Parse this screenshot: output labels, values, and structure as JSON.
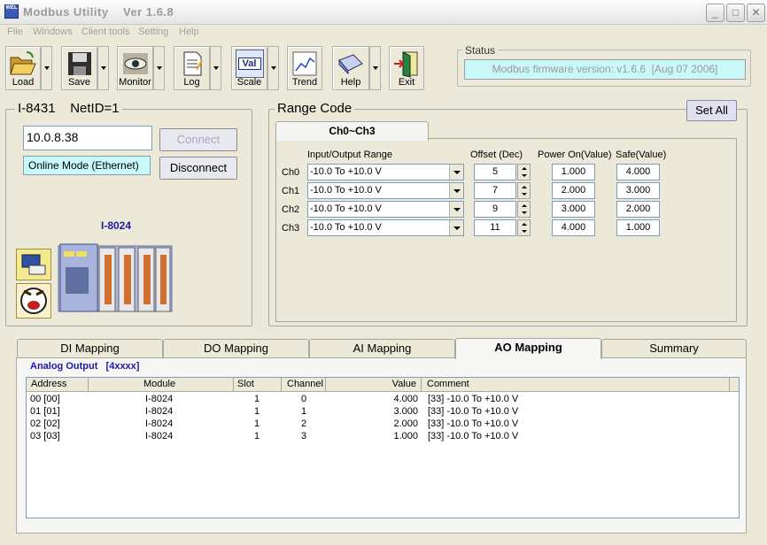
{
  "window": {
    "title": "Modbus Utility    Ver 1.6.8",
    "app_icon_text": "WEL"
  },
  "menu": [
    "File",
    "Windows",
    "Client tools",
    "Setting",
    "Help"
  ],
  "toolbar": {
    "buttons": [
      {
        "label": "Load",
        "icon": "folder-open-icon"
      },
      {
        "label": "Save",
        "icon": "floppy-disk-icon"
      },
      {
        "label": "Monitor",
        "icon": "eye-icon"
      },
      {
        "label": "Log",
        "icon": "log-document-icon"
      },
      {
        "label": "Scale",
        "icon": "scale-val-icon",
        "icon_text": "Val"
      },
      {
        "label": "Trend",
        "icon": "trend-chart-icon"
      },
      {
        "label": "Help",
        "icon": "help-book-icon"
      },
      {
        "label": "Exit",
        "icon": "exit-door-icon"
      }
    ]
  },
  "status": {
    "legend": "Status",
    "text": "Modbus firmware version: v1.6.6  [Aug 07 2006]"
  },
  "device": {
    "legend": "I-8431    NetID=1",
    "ip": "10.0.8.38",
    "connect_label": "Connect",
    "disconnect_label": "Disconnect",
    "mode": "Online Mode (Ethernet)",
    "module_name": "I-8024"
  },
  "range_code": {
    "legend": "Range Code",
    "set_all_label": "Set All",
    "tab_label": "Ch0~Ch3",
    "headers": {
      "range": "Input/Output Range",
      "offset": "Offset (Dec)",
      "power_on": "Power On(Value)",
      "safe": "Safe(Value)"
    },
    "channels": [
      {
        "name": "Ch0",
        "range": "-10.0 To +10.0 V",
        "offset": "5",
        "power_on": "1.000",
        "safe": "4.000"
      },
      {
        "name": "Ch1",
        "range": "-10.0 To +10.0 V",
        "offset": "7",
        "power_on": "2.000",
        "safe": "3.000"
      },
      {
        "name": "Ch2",
        "range": "-10.0 To +10.0 V",
        "offset": "9",
        "power_on": "3.000",
        "safe": "2.000"
      },
      {
        "name": "Ch3",
        "range": "-10.0 To +10.0 V",
        "offset": "11",
        "power_on": "4.000",
        "safe": "1.000"
      }
    ]
  },
  "mapping_tabs": [
    {
      "label": "DI Mapping",
      "active": false
    },
    {
      "label": "DO Mapping",
      "active": false
    },
    {
      "label": "AI Mapping",
      "active": false
    },
    {
      "label": "AO Mapping",
      "active": true
    },
    {
      "label": "Summary",
      "active": false
    }
  ],
  "ao": {
    "heading": "Analog Output   [4xxxx]",
    "columns": [
      "Address",
      "Module",
      "Slot",
      "Channel",
      "Value",
      "Comment"
    ],
    "rows": [
      {
        "address": "00 [00]",
        "module": "I-8024",
        "slot": "1",
        "channel": "0",
        "value": "4.000",
        "comment": "[33] -10.0 To +10.0 V"
      },
      {
        "address": "01 [01]",
        "module": "I-8024",
        "slot": "1",
        "channel": "1",
        "value": "3.000",
        "comment": "[33] -10.0 To +10.0 V"
      },
      {
        "address": "02 [02]",
        "module": "I-8024",
        "slot": "1",
        "channel": "2",
        "value": "2.000",
        "comment": "[33] -10.0 To +10.0 V"
      },
      {
        "address": "03 [03]",
        "module": "I-8024",
        "slot": "1",
        "channel": "3",
        "value": "1.000",
        "comment": "[33] -10.0 To +10.0 V"
      }
    ]
  },
  "colors": {
    "status_bg": "#c8f8f8",
    "heading_blue": "#1a1aa8",
    "window_bg": "#ece9d8"
  }
}
